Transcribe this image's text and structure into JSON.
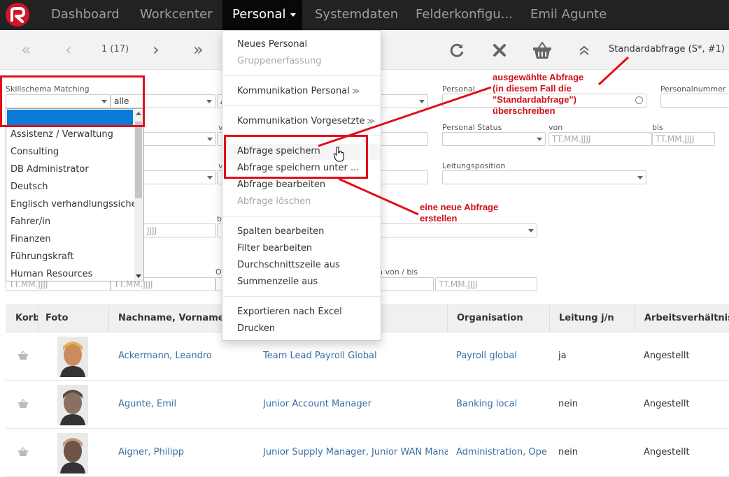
{
  "nav": {
    "items": [
      "Dashboard",
      "Workcenter",
      "Personal",
      "Systemdaten",
      "Felderkonfigu...",
      "Emil Agunte"
    ]
  },
  "pager": {
    "page": "1 (17)"
  },
  "toolbar": {
    "query_label": "Standardabfrage (S*, #1)"
  },
  "filters": {
    "skill_label": "Skillschema Matching",
    "skill_mode": "alle",
    "personal_label": "Personal",
    "personalnummer_label": "Personalnummer",
    "status_label": "Personal Status",
    "von_label": "von",
    "bis_label": "bis",
    "leitung_label": "Leitungsposition",
    "date_placeholder": "TT.MM.JJJJ",
    "date_fragment": "JJJJ",
    "v_label": "v",
    "bi_label": "bi",
    "o_label": "O",
    "range_label": "n von / bis",
    "a_value": "A"
  },
  "skills": [
    "Assistenz / Verwaltung",
    "Consulting",
    "DB Administrator",
    "Deutsch",
    "Englisch verhandlungssicher",
    "Fahrer/in",
    "Finanzen",
    "Führungskraft",
    "Human Resources"
  ],
  "menu": {
    "items": [
      {
        "label": "Neues Personal",
        "disabled": false
      },
      {
        "label": "Gruppenerfassung",
        "disabled": true
      },
      {
        "label": "Kommunikation Personal",
        "disabled": false
      },
      {
        "label": "Kommunikation Vorgesetzte",
        "disabled": false
      },
      {
        "label": "Abfrage speichern",
        "disabled": false
      },
      {
        "label": "Abfrage speichern unter ...",
        "disabled": false
      },
      {
        "label": "Abfrage bearbeiten",
        "disabled": false
      },
      {
        "label": "Abfrage löschen",
        "disabled": true
      },
      {
        "label": "Spalten bearbeiten",
        "disabled": false
      },
      {
        "label": "Filter bearbeiten",
        "disabled": false
      },
      {
        "label": "Durchschnittszeile aus",
        "disabled": false
      },
      {
        "label": "Summenzeile aus",
        "disabled": false
      },
      {
        "label": "Exportieren nach Excel",
        "disabled": false
      },
      {
        "label": "Drucken",
        "disabled": false
      }
    ]
  },
  "table": {
    "headers": [
      "Korb",
      "Foto",
      "Nachname, Vorname (Li",
      "Organisation",
      "Leitung j/n",
      "Arbeitsverhältnis"
    ],
    "rows": [
      {
        "name": "Ackermann, Leandro",
        "position": "Team Lead Payroll Global",
        "org": "Payroll global",
        "leitung": "ja",
        "arbeit": "Angestellt"
      },
      {
        "name": "Agunte, Emil",
        "position": "Junior Account Manager",
        "org": "Banking local",
        "leitung": "nein",
        "arbeit": "Angestellt"
      },
      {
        "name": "Aigner, Philipp",
        "position": "Junior Supply Manager, Junior WAN Manage",
        "org": "Administration, Opera",
        "leitung": "nein",
        "arbeit": "Angestellt"
      }
    ]
  },
  "annotations": {
    "query_note": "ausgewählte Abfrage\n(in diesem Fall die\n\"Standardabfrage\")\nüberschreiben",
    "new_note": "eine neue Abfrage\nerstellen"
  },
  "colors": {
    "accent_red": "#e0101a",
    "brand_red": "#d0152a",
    "link_blue": "#3b6ea5",
    "select_blue": "#0a7bd9"
  }
}
